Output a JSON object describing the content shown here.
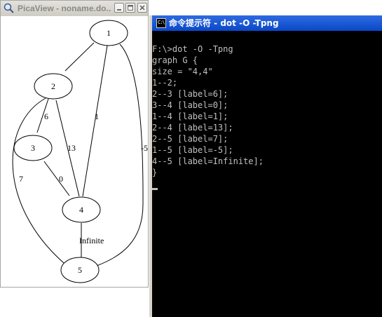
{
  "picaview": {
    "title": "PicaView - noname.do...",
    "app_icon": "magnifier-icon",
    "buttons": {
      "minimize": "minimize-icon",
      "maximize": "maximize-icon",
      "close": "close-icon"
    },
    "graph": {
      "nodes": [
        "1",
        "2",
        "3",
        "4",
        "5"
      ],
      "edges": [
        {
          "from": "1",
          "to": "2",
          "label": ""
        },
        {
          "from": "2",
          "to": "3",
          "label": "6"
        },
        {
          "from": "3",
          "to": "4",
          "label": "0"
        },
        {
          "from": "1",
          "to": "4",
          "label": "1"
        },
        {
          "from": "2",
          "to": "4",
          "label": "13"
        },
        {
          "from": "2",
          "to": "5",
          "label": "7"
        },
        {
          "from": "1",
          "to": "5",
          "label": "-5"
        },
        {
          "from": "4",
          "to": "5",
          "label": "Infinite"
        }
      ]
    }
  },
  "console": {
    "title": "命令提示符 - dot -O -Tpng",
    "icon_text": "C:\\",
    "lines": [
      "F:\\>dot -O -Tpng",
      "graph G {",
      "size = \"4,4\"",
      "1--2;",
      "2--3 [label=6];",
      "3--4 [label=0];",
      "1--4 [label=1];",
      "2--4 [label=13];",
      "2--5 [label=7];",
      "1--5 [label=-5];",
      "4--5 [label=Infinite];",
      "}"
    ]
  }
}
